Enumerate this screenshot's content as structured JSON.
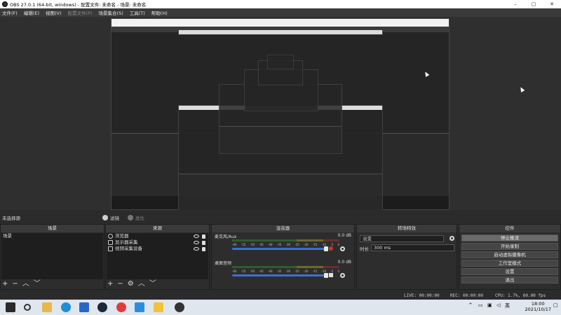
{
  "window": {
    "title": "OBS 27.0.1 (64-bit, windows) - 配置文件: 未命名 - 场景: 未命名",
    "minimize": "–",
    "maximize": "▢",
    "close": "✕"
  },
  "menu": [
    "文件(F)",
    "编辑(E)",
    "视图(V)",
    "配置文件(P)",
    "场景集合(S)",
    "工具(T)",
    "帮助(H)"
  ],
  "scenebar": {
    "current": "未选择源",
    "filter_label": "滤镜",
    "properties_label": "属性"
  },
  "scenes": {
    "title": "场景",
    "items": [
      "场景"
    ]
  },
  "sources": {
    "title": "来源",
    "items": [
      "浏览器",
      "显示器采集",
      "视频采集设备"
    ]
  },
  "mixer": {
    "title": "混音器",
    "channels": [
      {
        "name": "麦克风/Aux",
        "db": "0.0 dB",
        "muted": true
      },
      {
        "name": "桌面音频",
        "db": "0.0 dB",
        "muted": false
      }
    ],
    "ticks": [
      "-60",
      "-55",
      "-50",
      "-45",
      "-40",
      "-35",
      "-30",
      "-25",
      "-20",
      "-15",
      "-10",
      "-5",
      "0"
    ]
  },
  "transitions": {
    "title": "转场特效",
    "type": "淡变",
    "duration_label": "时长",
    "duration": "300 ms"
  },
  "controls": {
    "title": "控件",
    "buttons": [
      "停止推流",
      "开始录制",
      "启动虚拟摄像机",
      "工作室模式",
      "设置",
      "退出"
    ]
  },
  "status": {
    "live": "LIVE: 00:00:00",
    "rec": "REC: 00:00:00",
    "cpu": "CPU: 1.7%, 60.00 fps"
  },
  "taskbar": {
    "ime": "英",
    "time": "18:00",
    "date": "2021/10/17"
  },
  "colors": {
    "accent": "#3b6fd6",
    "muted_red": "#d23030",
    "selected": "#3d4c66"
  }
}
